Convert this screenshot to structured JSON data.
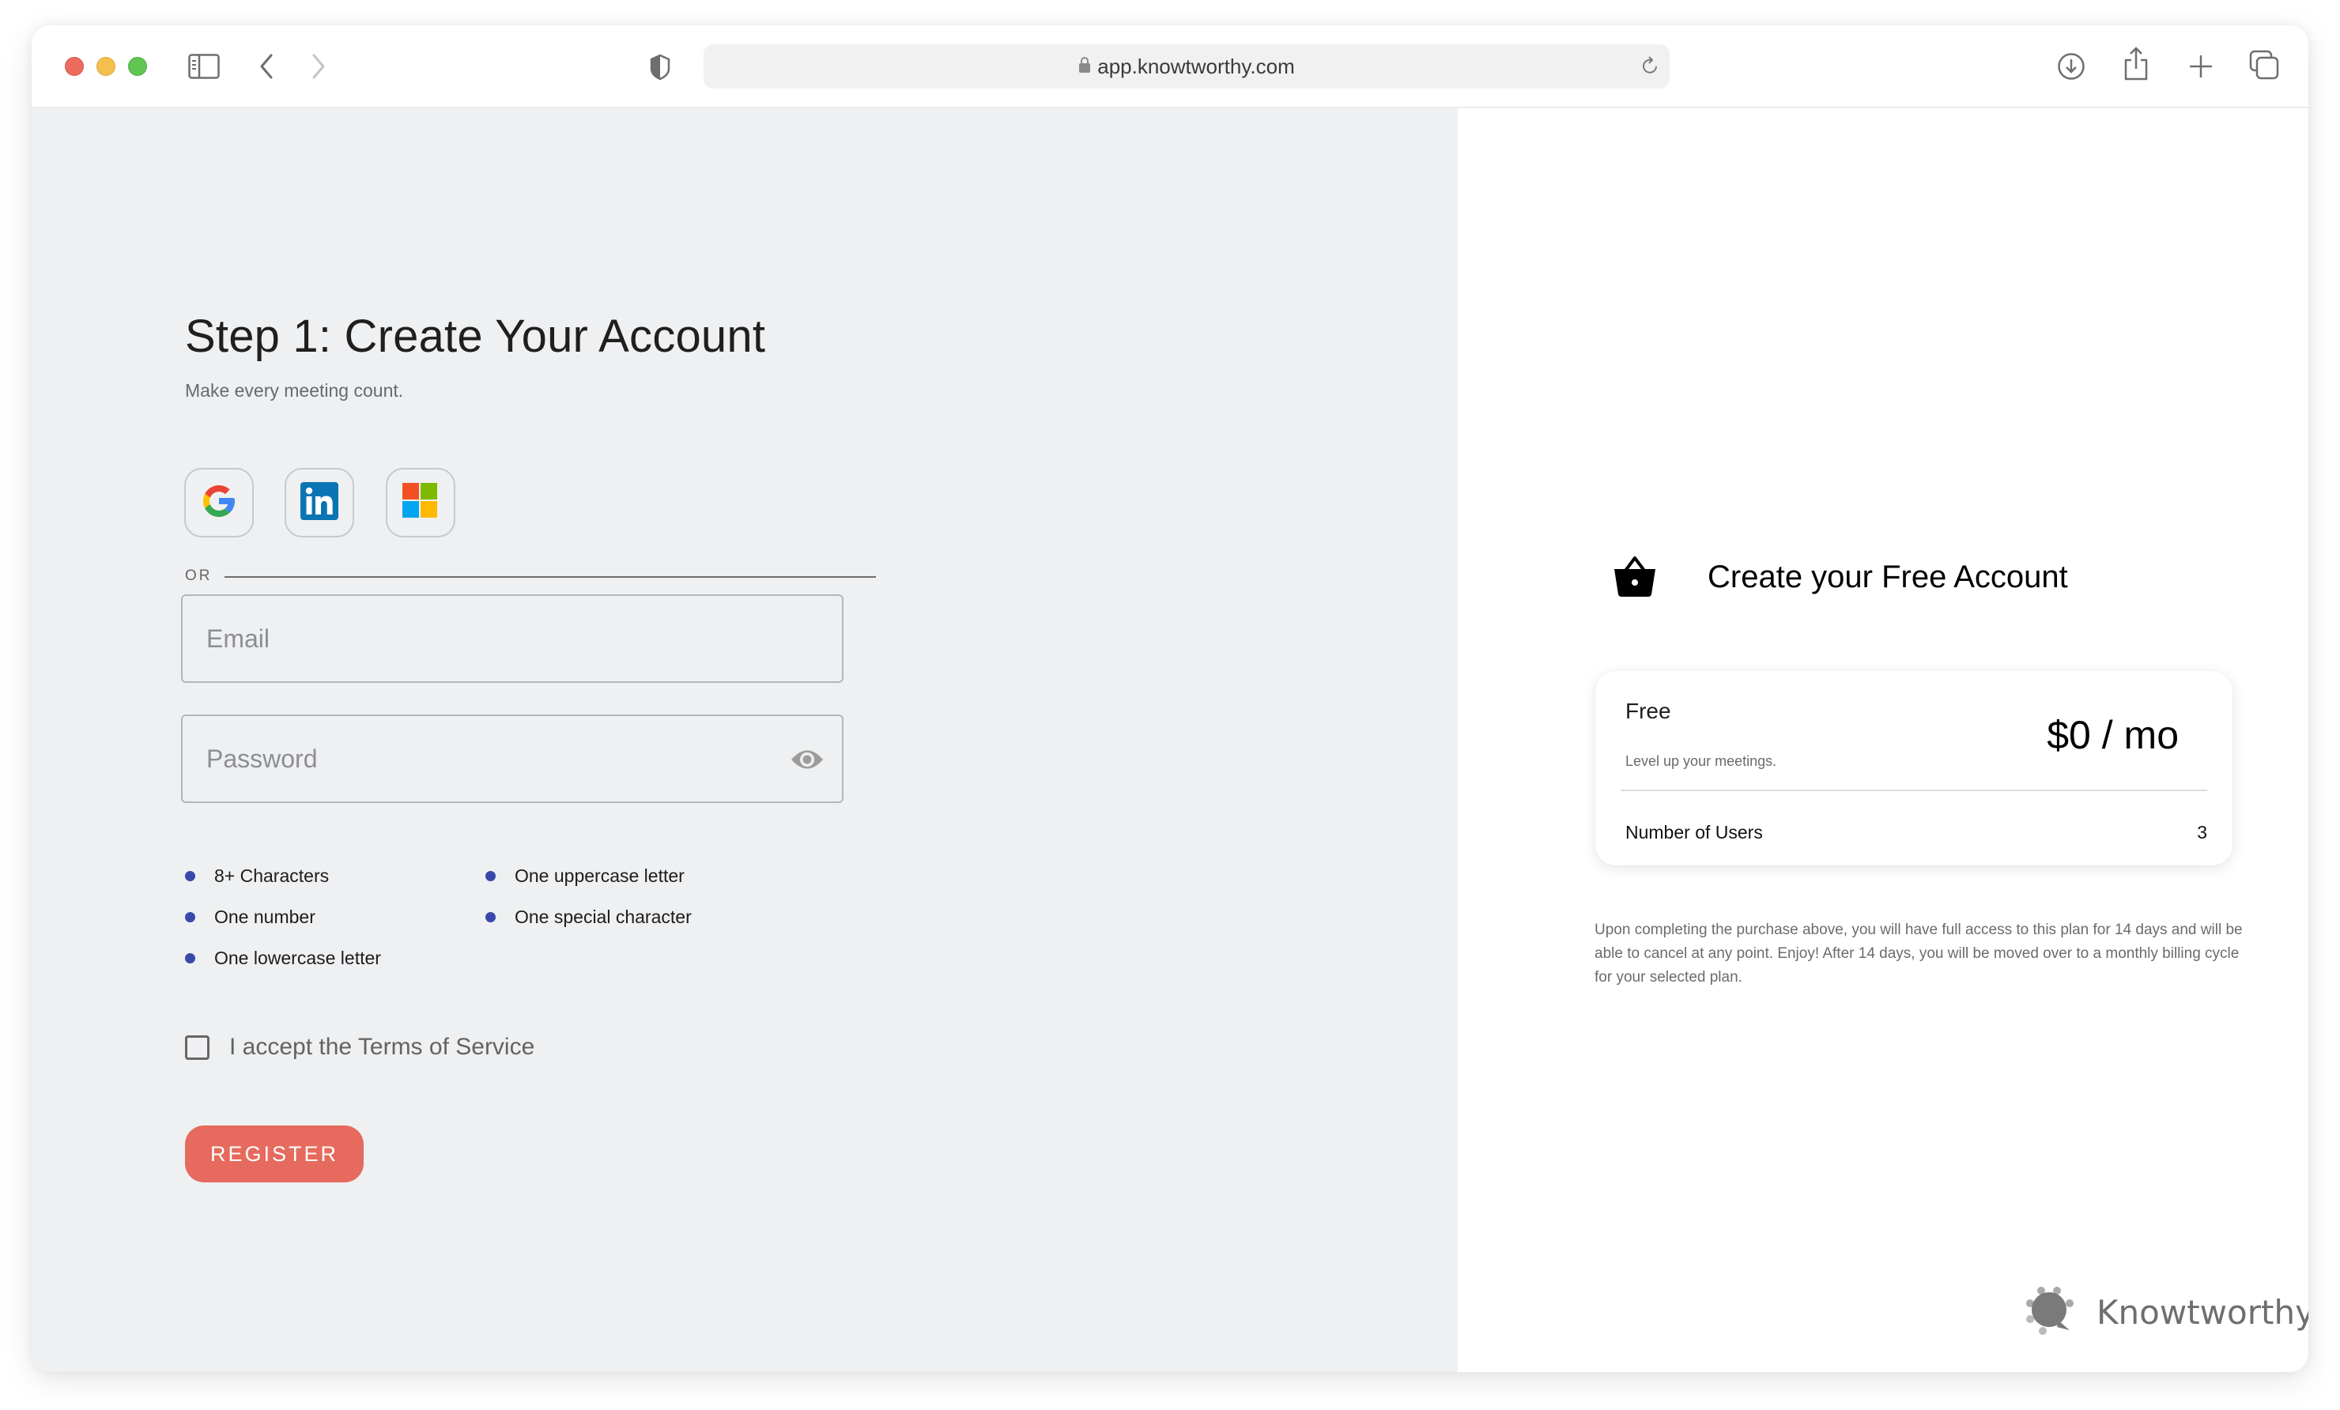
{
  "browser": {
    "url": "app.knowtworthy.com",
    "icons": {
      "close": "close-window",
      "minimize": "minimize-window",
      "zoom": "zoom-window",
      "sidebar": "sidebar-icon",
      "back": "back-icon",
      "forward": "forward-icon",
      "privacy": "shield-icon",
      "lock": "lock-icon",
      "reload": "reload-icon",
      "download": "download-icon",
      "share": "share-icon",
      "new_tab": "plus-icon",
      "tabs": "tab-overview-icon"
    }
  },
  "signup": {
    "title": "Step 1: Create Your Account",
    "subtitle": "Make every meeting count.",
    "social": [
      {
        "name": "Google",
        "icon": "google-icon"
      },
      {
        "name": "LinkedIn",
        "icon": "linkedin-icon"
      },
      {
        "name": "Microsoft",
        "icon": "microsoft-icon"
      }
    ],
    "or_label": "OR",
    "email": {
      "value": "",
      "placeholder": "Email"
    },
    "password": {
      "value": "",
      "placeholder": "Password",
      "icon": "eye-icon"
    },
    "requirements": [
      {
        "label": "8+ Characters"
      },
      {
        "label": "One number"
      },
      {
        "label": "One lowercase letter"
      },
      {
        "label": "One uppercase letter"
      },
      {
        "label": "One special character"
      }
    ],
    "terms_label": "I accept the Terms of Service",
    "terms_checked": false,
    "register_label": "REGISTER"
  },
  "plan": {
    "heading": "Create your Free Account",
    "heading_icon": "basket-icon",
    "name": "Free",
    "description": "Level up your meetings.",
    "price": "$0 / mo",
    "users_label": "Number of Users",
    "users_value": "3",
    "note": "Upon completing the purchase above, you will have full access to this plan for 14 days and will be able to cancel at any point. Enjoy! After 14 days, you will be moved over to a monthly billing cycle for your selected plan."
  },
  "brand": {
    "name": "Knowtworthy"
  },
  "colors": {
    "accent": "#e66a5e",
    "bullet": "#3949ab",
    "left_bg": "#eff0f2"
  }
}
